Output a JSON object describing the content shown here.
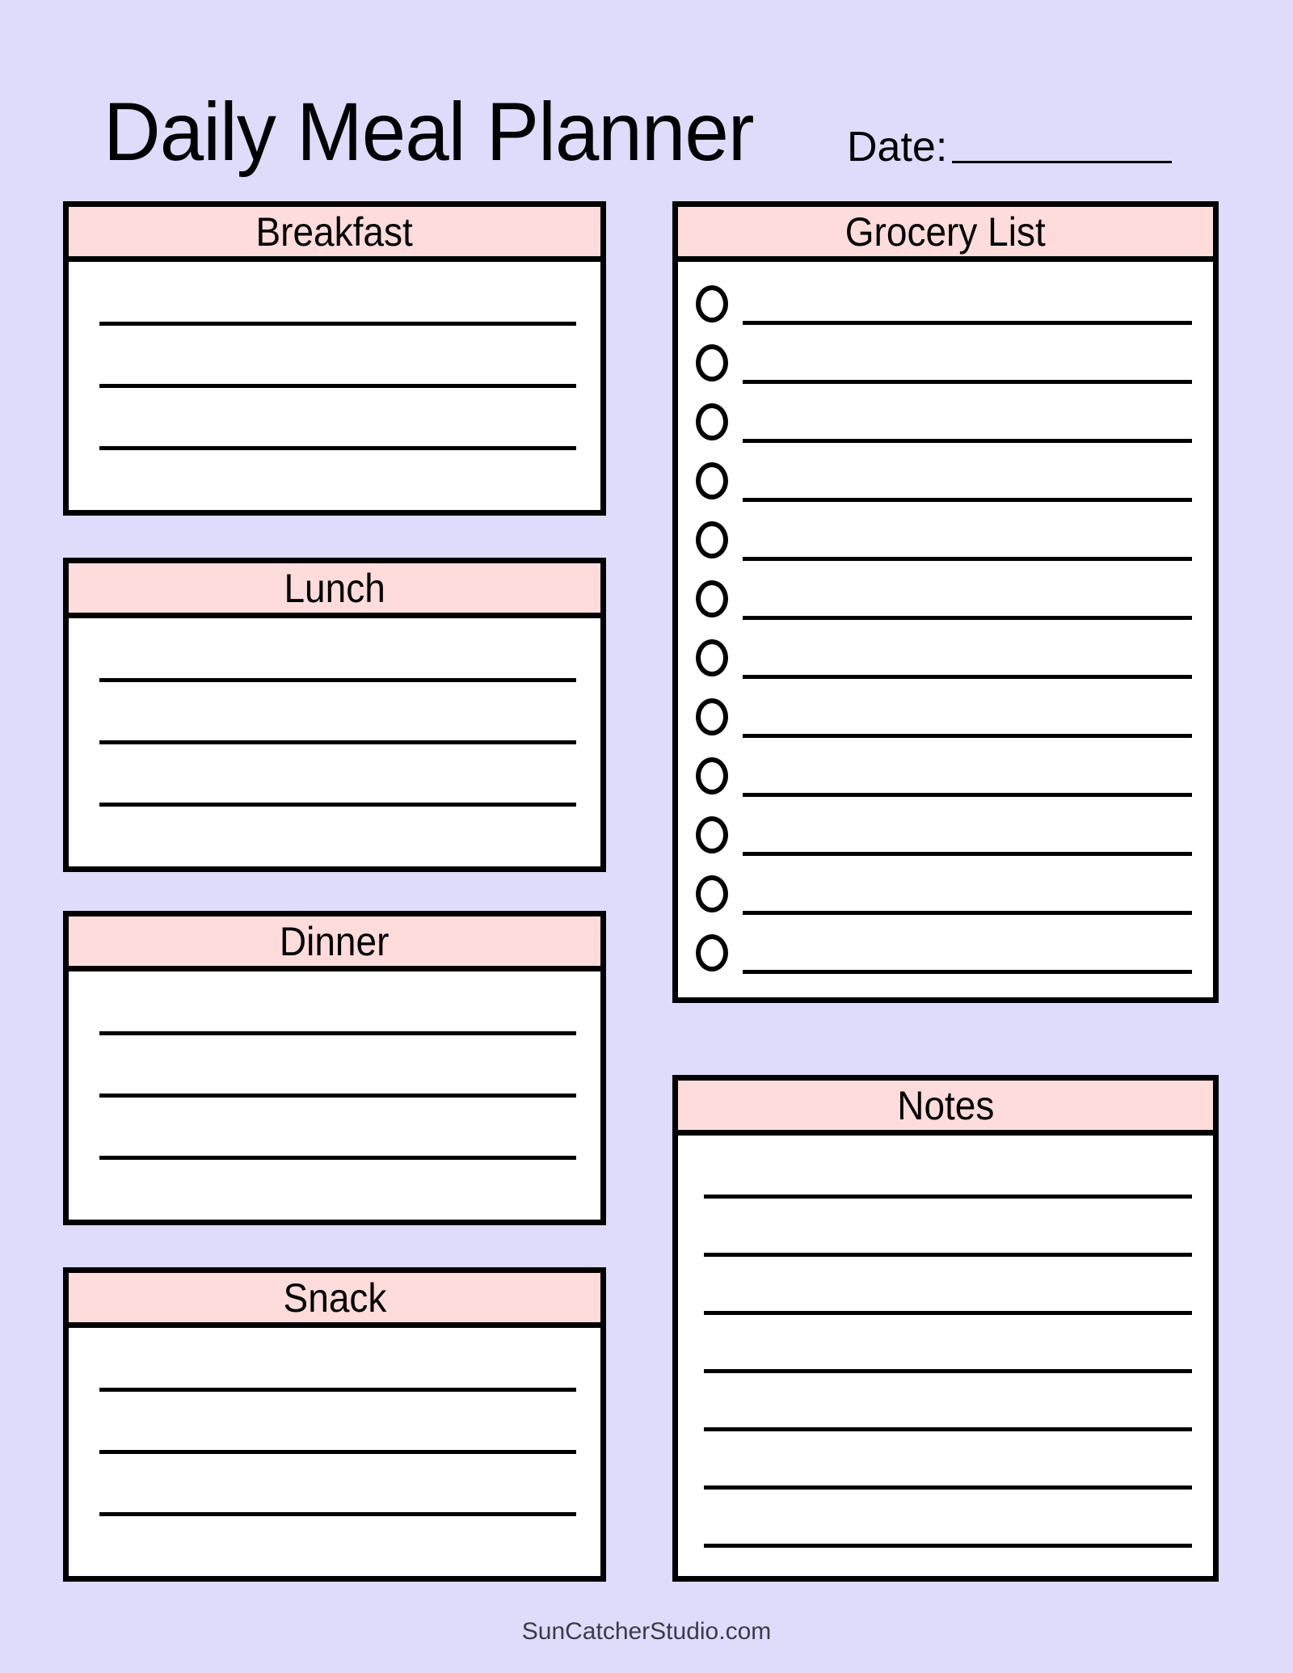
{
  "document": {
    "title": "Daily Meal Planner",
    "date_label": "Date:",
    "date_value": "",
    "footer": "SunCatcherStudio.com"
  },
  "colors": {
    "background": "#dedcfa",
    "header_fill": "#ffdcdc",
    "panel_fill": "#ffffff",
    "border": "#000000",
    "text": "#000000"
  },
  "panels": [
    {
      "id": "breakfast",
      "title": "Breakfast",
      "type": "lined",
      "line_count": 3,
      "column": "left"
    },
    {
      "id": "lunch",
      "title": "Lunch",
      "type": "lined",
      "line_count": 3,
      "column": "left"
    },
    {
      "id": "dinner",
      "title": "Dinner",
      "type": "lined",
      "line_count": 3,
      "column": "left"
    },
    {
      "id": "snack",
      "title": "Snack",
      "type": "lined",
      "line_count": 3,
      "column": "left"
    },
    {
      "id": "grocery-list",
      "title": "Grocery List",
      "type": "checklist",
      "line_count": 12,
      "column": "right"
    },
    {
      "id": "notes",
      "title": "Notes",
      "type": "lined",
      "line_count": 7,
      "column": "right"
    }
  ],
  "grocery_items": [
    "",
    "",
    "",
    "",
    "",
    "",
    "",
    "",
    "",
    "",
    "",
    ""
  ],
  "notes_items": [
    "",
    "",
    "",
    "",
    "",
    "",
    ""
  ],
  "meal_entries": {
    "breakfast": [
      "",
      "",
      ""
    ],
    "lunch": [
      "",
      "",
      ""
    ],
    "dinner": [
      "",
      "",
      ""
    ],
    "snack": [
      "",
      "",
      ""
    ]
  }
}
